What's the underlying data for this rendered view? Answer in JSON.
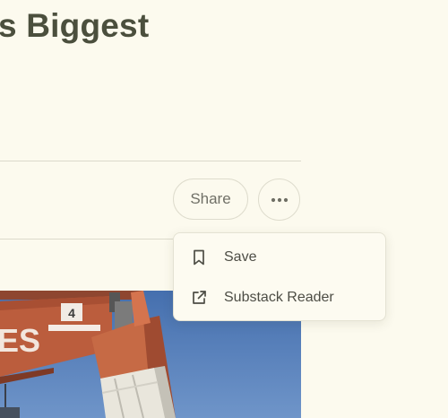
{
  "article": {
    "title": "s Biggest"
  },
  "actions": {
    "share_label": "Share"
  },
  "dropdown": {
    "items": [
      {
        "label": "Save",
        "icon": "bookmark-icon"
      },
      {
        "label": "Substack Reader",
        "icon": "external-link-icon"
      }
    ]
  },
  "image": {
    "sign_text": "ES",
    "badge_number": "4"
  }
}
